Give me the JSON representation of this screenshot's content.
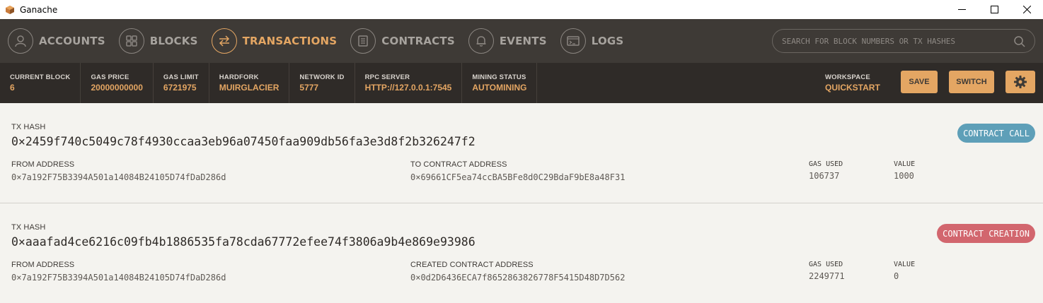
{
  "window": {
    "title": "Ganache"
  },
  "nav": {
    "items": [
      {
        "label": "ACCOUNTS",
        "active": false
      },
      {
        "label": "BLOCKS",
        "active": false
      },
      {
        "label": "TRANSACTIONS",
        "active": true
      },
      {
        "label": "CONTRACTS",
        "active": false
      },
      {
        "label": "EVENTS",
        "active": false
      },
      {
        "label": "LOGS",
        "active": false
      }
    ],
    "search_placeholder": "SEARCH FOR BLOCK NUMBERS OR TX HASHES"
  },
  "status": {
    "items": [
      {
        "label": "CURRENT BLOCK",
        "value": "6"
      },
      {
        "label": "GAS PRICE",
        "value": "20000000000"
      },
      {
        "label": "GAS LIMIT",
        "value": "6721975"
      },
      {
        "label": "HARDFORK",
        "value": "MUIRGLACIER"
      },
      {
        "label": "NETWORK ID",
        "value": "5777"
      },
      {
        "label": "RPC SERVER",
        "value": "HTTP://127.0.0.1:7545"
      },
      {
        "label": "MINING STATUS",
        "value": "AUTOMINING"
      }
    ],
    "workspace": {
      "label": "WORKSPACE",
      "value": "QUICKSTART"
    },
    "save_label": "SAVE",
    "switch_label": "SWITCH"
  },
  "transactions": [
    {
      "hash_label": "TX HASH",
      "hash": "0×2459f740c5049c78f4930ccaa3eb96a07450faa909db56fa3e3d8f2b326247f2",
      "from_label": "FROM ADDRESS",
      "from": "0×7a192F75B3394A501a14084B24105D74fDaD286d",
      "to_label": "TO CONTRACT ADDRESS",
      "to": "0×69661CF5ea74ccBA5BFe8d0C29BdaF9bE8a48F31",
      "gas_label": "GAS USED",
      "gas": "106737",
      "value_label": "VALUE",
      "value": "1000",
      "badge": "CONTRACT CALL",
      "badge_color": "#5e9fb8"
    },
    {
      "hash_label": "TX HASH",
      "hash": "0×aaafad4ce6216c09fb4b1886535fa78cda67772efee74f3806a9b4e869e93986",
      "from_label": "FROM ADDRESS",
      "from": "0×7a192F75B3394A501a14084B24105D74fDaD286d",
      "to_label": "CREATED CONTRACT ADDRESS",
      "to": "0×0d2D6436ECA7f8652863826778F5415D48D7D562",
      "gas_label": "GAS USED",
      "gas": "2249771",
      "value_label": "VALUE",
      "value": "0",
      "badge": "CONTRACT CREATION",
      "badge_color": "#d2666e"
    }
  ]
}
